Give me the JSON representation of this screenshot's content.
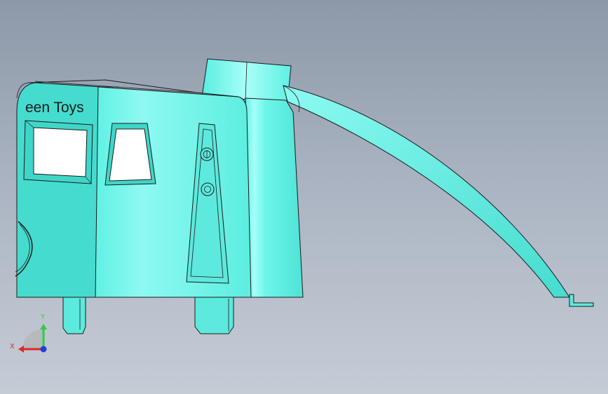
{
  "model": {
    "logo_text": "een Toys",
    "body_color": "#5ff0e3",
    "body_shadow_color": "#45d7cc",
    "outline_color": "#1a1a1a"
  },
  "triad": {
    "x_label": "X",
    "y_label": "Y",
    "x_color": "#e32626",
    "y_color": "#2ecc40",
    "z_color": "#1f3fd6"
  }
}
